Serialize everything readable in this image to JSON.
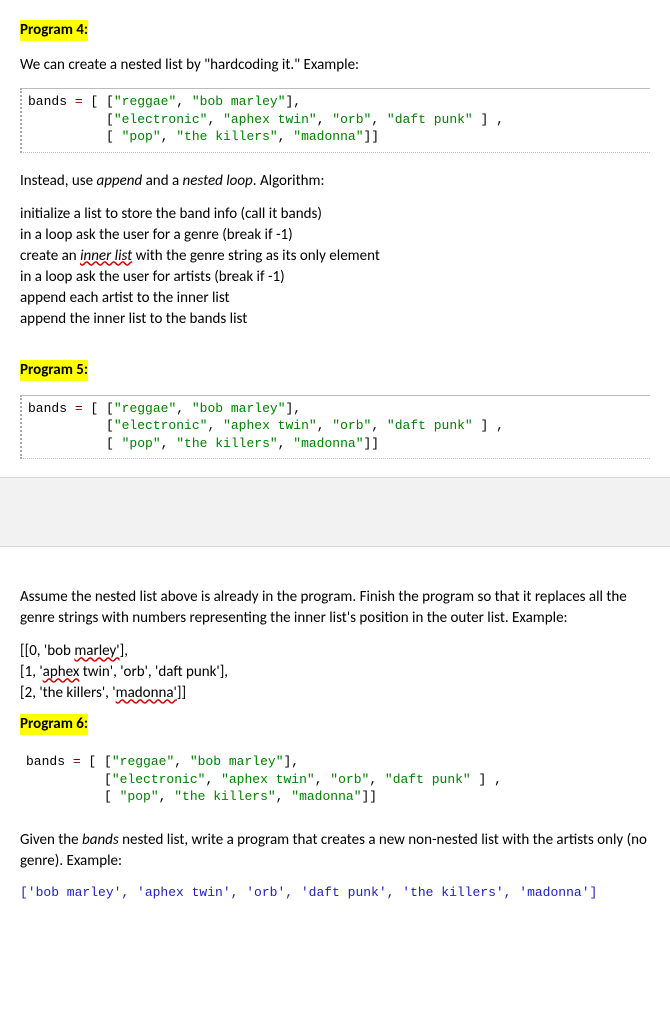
{
  "program4": {
    "title": "Program 4:",
    "intro_a": "We can create a nested list by \"hardcoding it.\" Example:",
    "code": "bands = [ [\"reggae\", \"bob marley\"],\n          [\"electronic\", \"aphex twin\", \"orb\", \"daft punk\" ] ,\n          [ \"pop\", \"the killers\", \"madonna\"]]",
    "instead_prefix": "Instead, use ",
    "instead_append": "append",
    "instead_mid": " and a ",
    "instead_nested": "nested loop",
    "instead_suffix": ". Algorithm:",
    "algo": [
      "initialize a list to store the band info (call it bands)",
      "in a loop ask the user for a genre (break if -1)",
      {
        "pre": "create an ",
        "sq": "inner list",
        "post": " with the genre string as its only element"
      },
      "in a loop ask the user for artists (break if -1)",
      "append each artist to the inner list",
      "append the inner list to the bands list"
    ]
  },
  "program5": {
    "title": "Program 5:",
    "code": "bands = [ [\"reggae\", \"bob marley\"],\n          [\"electronic\", \"aphex twin\", \"orb\", \"daft punk\" ] ,\n          [ \"pop\", \"the killers\", \"madonna\"]]",
    "task": "Assume the nested list above is already in the program. Finish the program so that it replaces all the genre strings with numbers representing the inner list's position in the outer list. Example:",
    "out1": {
      "a": "[[0, 'bob ",
      "sq": "marley'",
      "b": "],"
    },
    "out2": {
      "a": "[1, '",
      "sq": "aphex",
      "b": " twin', 'orb', 'daft punk'],"
    },
    "out3": {
      "a": "[2, 'the killers', '",
      "sq": "madonna'",
      "b": "]]"
    }
  },
  "program6": {
    "title": "Program 6:",
    "code": "bands = [ [\"reggae\", \"bob marley\"],\n          [\"electronic\", \"aphex twin\", \"orb\", \"daft punk\" ] ,\n          [ \"pop\", \"the killers\", \"madonna\"]]",
    "task_pre": "Given the ",
    "task_it": "bands",
    "task_post": " nested list, write a program that creates a new non-nested list with the artists only (no genre). Example:",
    "output": "['bob marley', 'aphex twin', 'orb', 'daft punk', 'the killers', 'madonna']"
  }
}
